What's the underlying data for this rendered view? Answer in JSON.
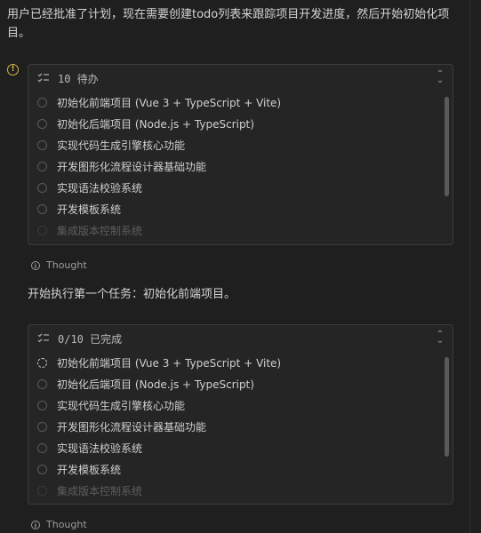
{
  "intro_text": "用户已经批准了计划，现在需要创建todo列表来跟踪项目开发进度，然后开始初始化项目。",
  "panels": [
    {
      "header": "10 待办",
      "items": [
        "初始化前端项目 (Vue 3 + TypeScript + Vite)",
        "初始化后端项目 (Node.js + TypeScript)",
        "实现代码生成引擎核心功能",
        "开发图形化流程设计器基础功能",
        "实现语法校验系统",
        "开发模板系统",
        "集成版本控制系统"
      ]
    },
    {
      "header": "0/10 已完成",
      "items": [
        "初始化前端项目 (Vue 3 + TypeScript + Vite)",
        "初始化后端项目 (Node.js + TypeScript)",
        "实现代码生成引擎核心功能",
        "开发图形化流程设计器基础功能",
        "实现语法校验系统",
        "开发模板系统",
        "集成版本控制系统"
      ]
    }
  ],
  "thought_label": "Thought",
  "message_text": "开始执行第一个任务：初始化前端项目。",
  "colors": {
    "warning": "#d8b545",
    "background": "#1f1f1f",
    "panel": "#252526"
  },
  "icons": [
    "warning-icon",
    "checklist-icon",
    "collapse-icon",
    "info-icon",
    "progress-spinner-icon"
  ]
}
